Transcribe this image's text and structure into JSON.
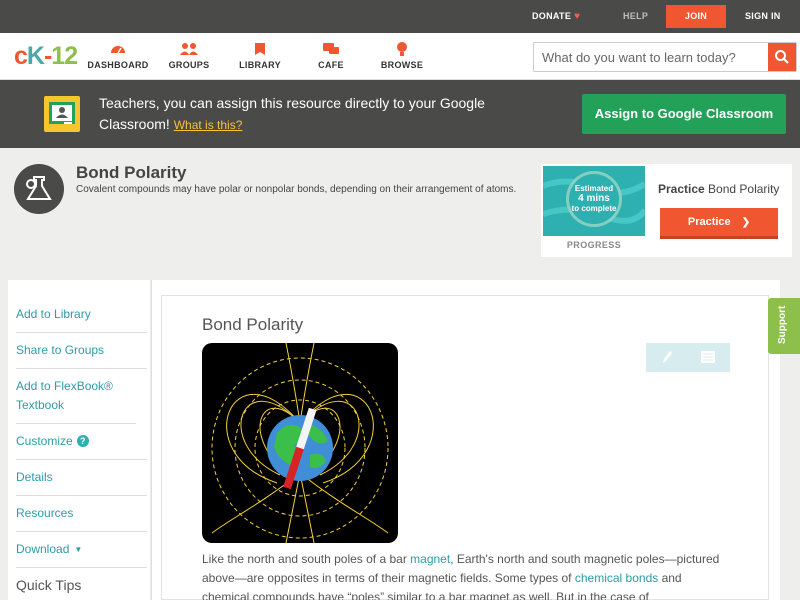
{
  "topbar": {
    "donate": "DONATE",
    "help": "HELP",
    "join": "JOIN",
    "signin": "SIGN IN"
  },
  "nav": {
    "logo": {
      "c": "c",
      "k": "K",
      "dash": "-",
      "num": "12"
    },
    "items": [
      "DASHBOARD",
      "GROUPS",
      "LIBRARY",
      "CAFE",
      "BROWSE"
    ],
    "search_placeholder": "What do you want to learn today?"
  },
  "banner": {
    "message": "Teachers, you can assign this resource directly to your Google Classroom!",
    "what_link": "What is this?",
    "assign_button": "Assign to Google Classroom"
  },
  "concept": {
    "title": "Bond Polarity",
    "description": "Covalent compounds may have polar or nonpolar bonds, depending on their arrangement of atoms."
  },
  "practice": {
    "estimated": "Estimated",
    "mins": "4 mins",
    "to_complete": "to complete",
    "progress_label": "PROGRESS",
    "title_bold": "Practice",
    "title_rest": " Bond Polarity",
    "button": "Practice"
  },
  "sidebar": {
    "items": [
      "Add to Library",
      "Share to Groups",
      "Add to FlexBook® Textbook",
      "Customize",
      "Details",
      "Resources",
      "Download"
    ],
    "quick_tips": "Quick Tips"
  },
  "content": {
    "title": "Bond Polarity",
    "p1_a": "Like the north and south poles of a bar ",
    "p1_link1": "magnet",
    "p1_b": ", Earth's north and south magnetic poles—pictured above—are opposites in terms of their magnetic fields. Some types of ",
    "p1_link2": "chemical bonds",
    "p1_c": " and chemical compounds have “poles” similar to a bar magnet as well. But in the case of"
  },
  "support": "Support",
  "colors": {
    "accent": "#f0562f",
    "teal": "#2e9ba5",
    "green": "#24a158",
    "support_green": "#8cc04b",
    "dark_bar": "#4a4a48"
  }
}
